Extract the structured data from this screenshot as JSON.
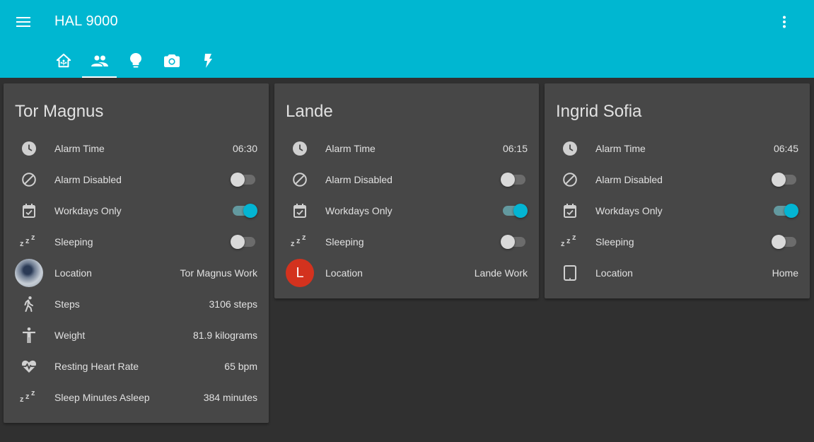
{
  "app": {
    "title": "HAL 9000",
    "menu_icon": "menu-icon",
    "more_icon": "more-vert-icon",
    "accent": "#03b5d3",
    "header_color": "#00b7d1"
  },
  "tabs": [
    {
      "icon": "home-assistant-icon",
      "active": false
    },
    {
      "icon": "people-icon",
      "active": true
    },
    {
      "icon": "lightbulb-icon",
      "active": false
    },
    {
      "icon": "camera-icon",
      "active": false
    },
    {
      "icon": "flash-icon",
      "active": false
    }
  ],
  "cards": [
    {
      "title": "Tor Magnus",
      "rows": [
        {
          "icon": "clock-icon",
          "label": "Alarm Time",
          "value": "06:30"
        },
        {
          "icon": "cancel-icon",
          "label": "Alarm Disabled",
          "toggle": false
        },
        {
          "icon": "calendar-check-icon",
          "label": "Workdays Only",
          "toggle": true
        },
        {
          "icon": "sleep-icon",
          "label": "Sleeping",
          "toggle": false
        },
        {
          "icon": "avatar-photo",
          "label": "Location",
          "value": "Tor Magnus Work"
        },
        {
          "icon": "walk-icon",
          "label": "Steps",
          "value": "3106 steps"
        },
        {
          "icon": "human-icon",
          "label": "Weight",
          "value": "81.9 kilograms"
        },
        {
          "icon": "heart-pulse-icon",
          "label": "Resting Heart Rate",
          "value": "65 bpm"
        },
        {
          "icon": "sleep-icon",
          "label": "Sleep Minutes Asleep",
          "value": "384 minutes"
        }
      ]
    },
    {
      "title": "Lande",
      "rows": [
        {
          "icon": "clock-icon",
          "label": "Alarm Time",
          "value": "06:15"
        },
        {
          "icon": "cancel-icon",
          "label": "Alarm Disabled",
          "toggle": false
        },
        {
          "icon": "calendar-check-icon",
          "label": "Workdays Only",
          "toggle": true
        },
        {
          "icon": "sleep-icon",
          "label": "Sleeping",
          "toggle": false
        },
        {
          "icon": "avatar-letter",
          "avatar_letter": "L",
          "label": "Location",
          "value": "Lande Work"
        }
      ]
    },
    {
      "title": "Ingrid Sofia",
      "rows": [
        {
          "icon": "clock-icon",
          "label": "Alarm Time",
          "value": "06:45"
        },
        {
          "icon": "cancel-icon",
          "label": "Alarm Disabled",
          "toggle": false
        },
        {
          "icon": "calendar-check-icon",
          "label": "Workdays Only",
          "toggle": true
        },
        {
          "icon": "sleep-icon",
          "label": "Sleeping",
          "toggle": false
        },
        {
          "icon": "tablet-icon",
          "label": "Location",
          "value": "Home"
        }
      ]
    }
  ]
}
